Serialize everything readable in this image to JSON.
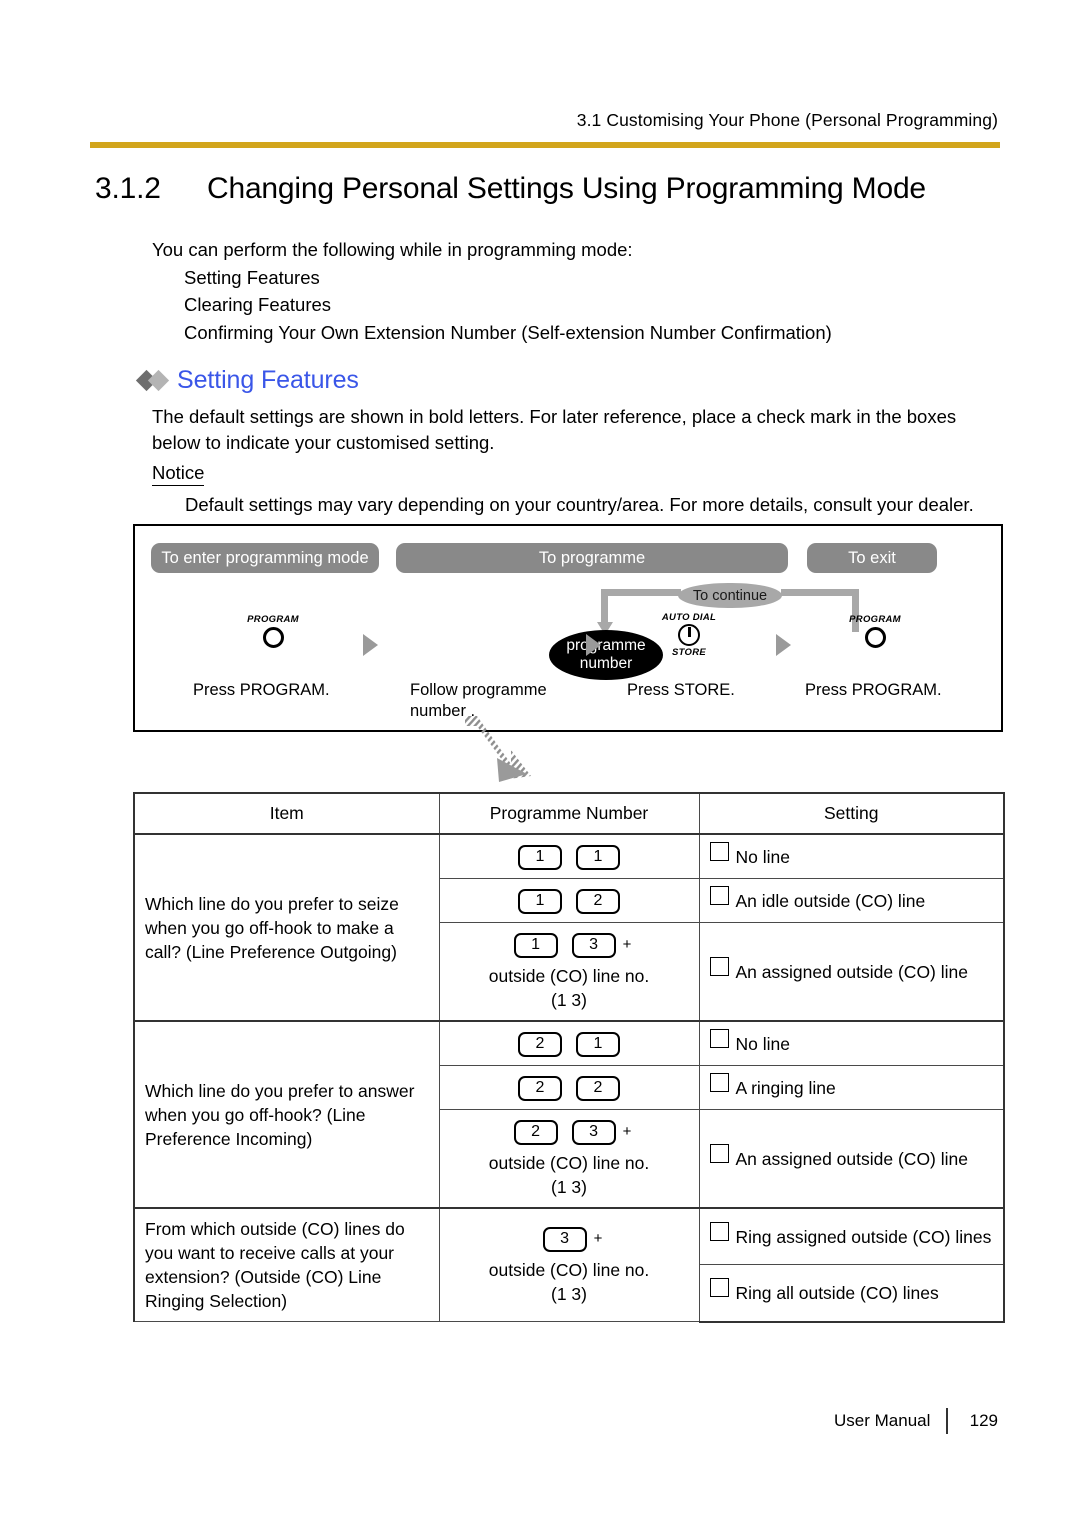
{
  "page": {
    "running_header": "3.1 Customising Your Phone (Personal Programming)",
    "rule_color": "#D2A51C",
    "section_number": "3.1.2",
    "section_title": "Changing Personal Settings Using Programming Mode",
    "footer_label": "User Manual",
    "footer_page": "129"
  },
  "intro": {
    "lead": "You can perform the following while in programming mode:",
    "items": [
      "Setting Features",
      "Clearing Features",
      "Confirming Your Own Extension Number (Self-extension Number Confirmation)"
    ]
  },
  "subhead": {
    "text": "Setting Features",
    "color": "#3A56E8",
    "diamond1_color": "#6E6E6E",
    "diamond2_color": "#B4B4B4"
  },
  "paragraph": "The default settings are shown in bold letters. For later reference, place a check mark in the boxes below to indicate your customised setting.",
  "notice": {
    "label": "Notice",
    "text": "Default settings may vary depending on your country/area. For more details, consult your dealer."
  },
  "flow": {
    "banner_color": "#898989",
    "banners": [
      {
        "label": "To enter programming mode"
      },
      {
        "label": "To programme"
      },
      {
        "label": "To exit"
      }
    ],
    "continue_label": "To continue",
    "oval_line1": "programme",
    "oval_line2": "number",
    "program_key_label": "PROGRAM",
    "store_key_top_label": "AUTO DIAL",
    "store_key_bottom_label": "STORE",
    "captions": [
      "Press PROGRAM.",
      "Follow programme number .",
      "Press STORE.",
      "Press PROGRAM."
    ]
  },
  "table": {
    "headers": [
      "Item",
      "Programme Number",
      "Setting"
    ],
    "sections": [
      {
        "item": "Which line do you prefer to seize when you go off-hook to make a call? (Line Preference Outgoing)",
        "rows": [
          {
            "keys": [
              "1",
              "1"
            ],
            "plus": "",
            "extra1": "",
            "extra2": "",
            "setting": "No line"
          },
          {
            "keys": [
              "1",
              "2"
            ],
            "plus": "",
            "extra1": "",
            "extra2": "",
            "setting": "An idle outside (CO) line"
          },
          {
            "keys": [
              "1",
              "3"
            ],
            "plus": "+",
            "extra1": "outside (CO) line no.",
            "extra2": "(1 3)",
            "setting": "An assigned outside (CO) line"
          }
        ]
      },
      {
        "item": "Which line do you prefer to answer when you go off-hook? (Line Preference Incoming)",
        "rows": [
          {
            "keys": [
              "2",
              "1"
            ],
            "plus": "",
            "extra1": "",
            "extra2": "",
            "setting": "No line"
          },
          {
            "keys": [
              "2",
              "2"
            ],
            "plus": "",
            "extra1": "",
            "extra2": "",
            "setting": "A ringing line"
          },
          {
            "keys": [
              "2",
              "3"
            ],
            "plus": "+",
            "extra1": "outside (CO) line no.",
            "extra2": "(1 3)",
            "setting": "An assigned outside (CO) line"
          }
        ]
      },
      {
        "item": "From which outside (CO) lines do you want to receive calls at your extension? (Outside (CO) Line Ringing Selection)",
        "rows": [
          {
            "keys": [
              "3"
            ],
            "plus": "+",
            "extra1": "outside (CO) line no.",
            "extra2": "(1 3)",
            "setting": "Ring assigned outside (CO) lines"
          },
          {
            "keys": [],
            "plus": "",
            "extra1": "",
            "extra2": "",
            "setting": "Ring all outside (CO) lines"
          }
        ]
      }
    ]
  }
}
